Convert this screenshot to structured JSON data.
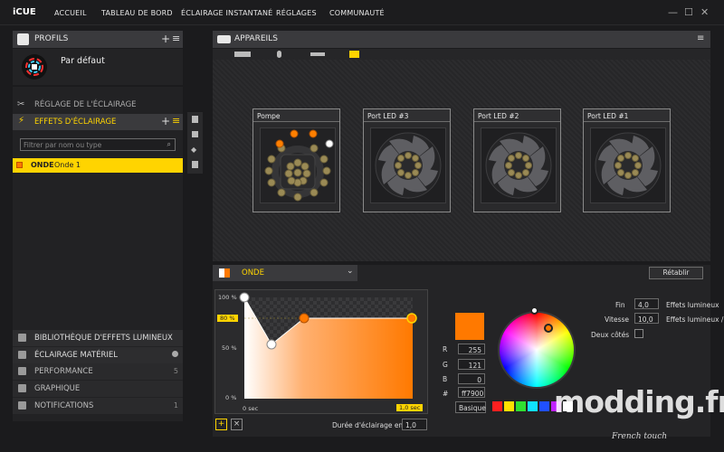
{
  "app": {
    "title": "iCUE"
  },
  "nav": {
    "items": [
      "ACCUEIL",
      "TABLEAU DE BORD",
      "ÉCLAIRAGE INSTANTANÉ",
      "RÉGLAGES",
      "COMMUNAUTÉ"
    ]
  },
  "window": {
    "min": "—",
    "max": "☐",
    "close": "✕"
  },
  "profiles": {
    "title": "PROFILS",
    "default_name": "Par défaut"
  },
  "sidebar": {
    "lighting_setup": "RÉGLAGE DE L'ÉCLAIRAGE",
    "lighting_effects": "EFFETS D'ÉCLAIRAGE",
    "filter_placeholder": "Filtrer par nom ou type",
    "effect": {
      "name": "ONDE",
      "desc": "Onde 1"
    },
    "library": "BIBLIOTHÈQUE D'EFFETS LUMINEUX",
    "hardware": "ÉCLAIRAGE MATÉRIEL",
    "performance": "PERFORMANCE",
    "performance_count": "5",
    "graphics": "GRAPHIQUE",
    "notifications": "NOTIFICATIONS",
    "notifications_count": "1"
  },
  "devices": {
    "title": "APPAREILS",
    "cards": [
      {
        "name": "Pompe"
      },
      {
        "name": "Port LED #3"
      },
      {
        "name": "Port LED #2"
      },
      {
        "name": "Port LED #1"
      }
    ]
  },
  "effect_panel": {
    "effect_name": "ONDE",
    "reset_button": "Rétablir",
    "y_ticks": [
      "100 %",
      "80 %",
      "50 %",
      "0 %"
    ],
    "x_start": "0 sec",
    "x_end": "1,0 sec",
    "duration_label": "Durée d'éclairage en s",
    "duration_value": "1,0",
    "add": "+",
    "remove": "×",
    "curve": {
      "points": [
        [
          0,
          100
        ],
        [
          0.16,
          50
        ],
        [
          0.35,
          80
        ],
        [
          1.0,
          80
        ]
      ],
      "highlight_level": 80
    }
  },
  "color": {
    "swatch": "#ff7900",
    "r_label": "R",
    "r": "255",
    "g_label": "G",
    "g": "121",
    "b_label": "B",
    "b": "0",
    "hex_label": "#",
    "hex": "ff7900",
    "basic_button": "Basique",
    "presets": [
      "#ff2020",
      "#ffe000",
      "#30e030",
      "#10e0ff",
      "#2050ff",
      "#c020ff",
      "#ffffff"
    ]
  },
  "params": {
    "fin_label": "Fin",
    "fin_value": "4,0",
    "fin_unit": "Effets lumineux",
    "speed_label": "Vitesse",
    "speed_value": "10,0",
    "speed_unit": "Effets lumineux /",
    "both_sides_label": "Deux côtés"
  },
  "watermark": {
    "text": "modding.fr",
    "sub": "French touch"
  }
}
